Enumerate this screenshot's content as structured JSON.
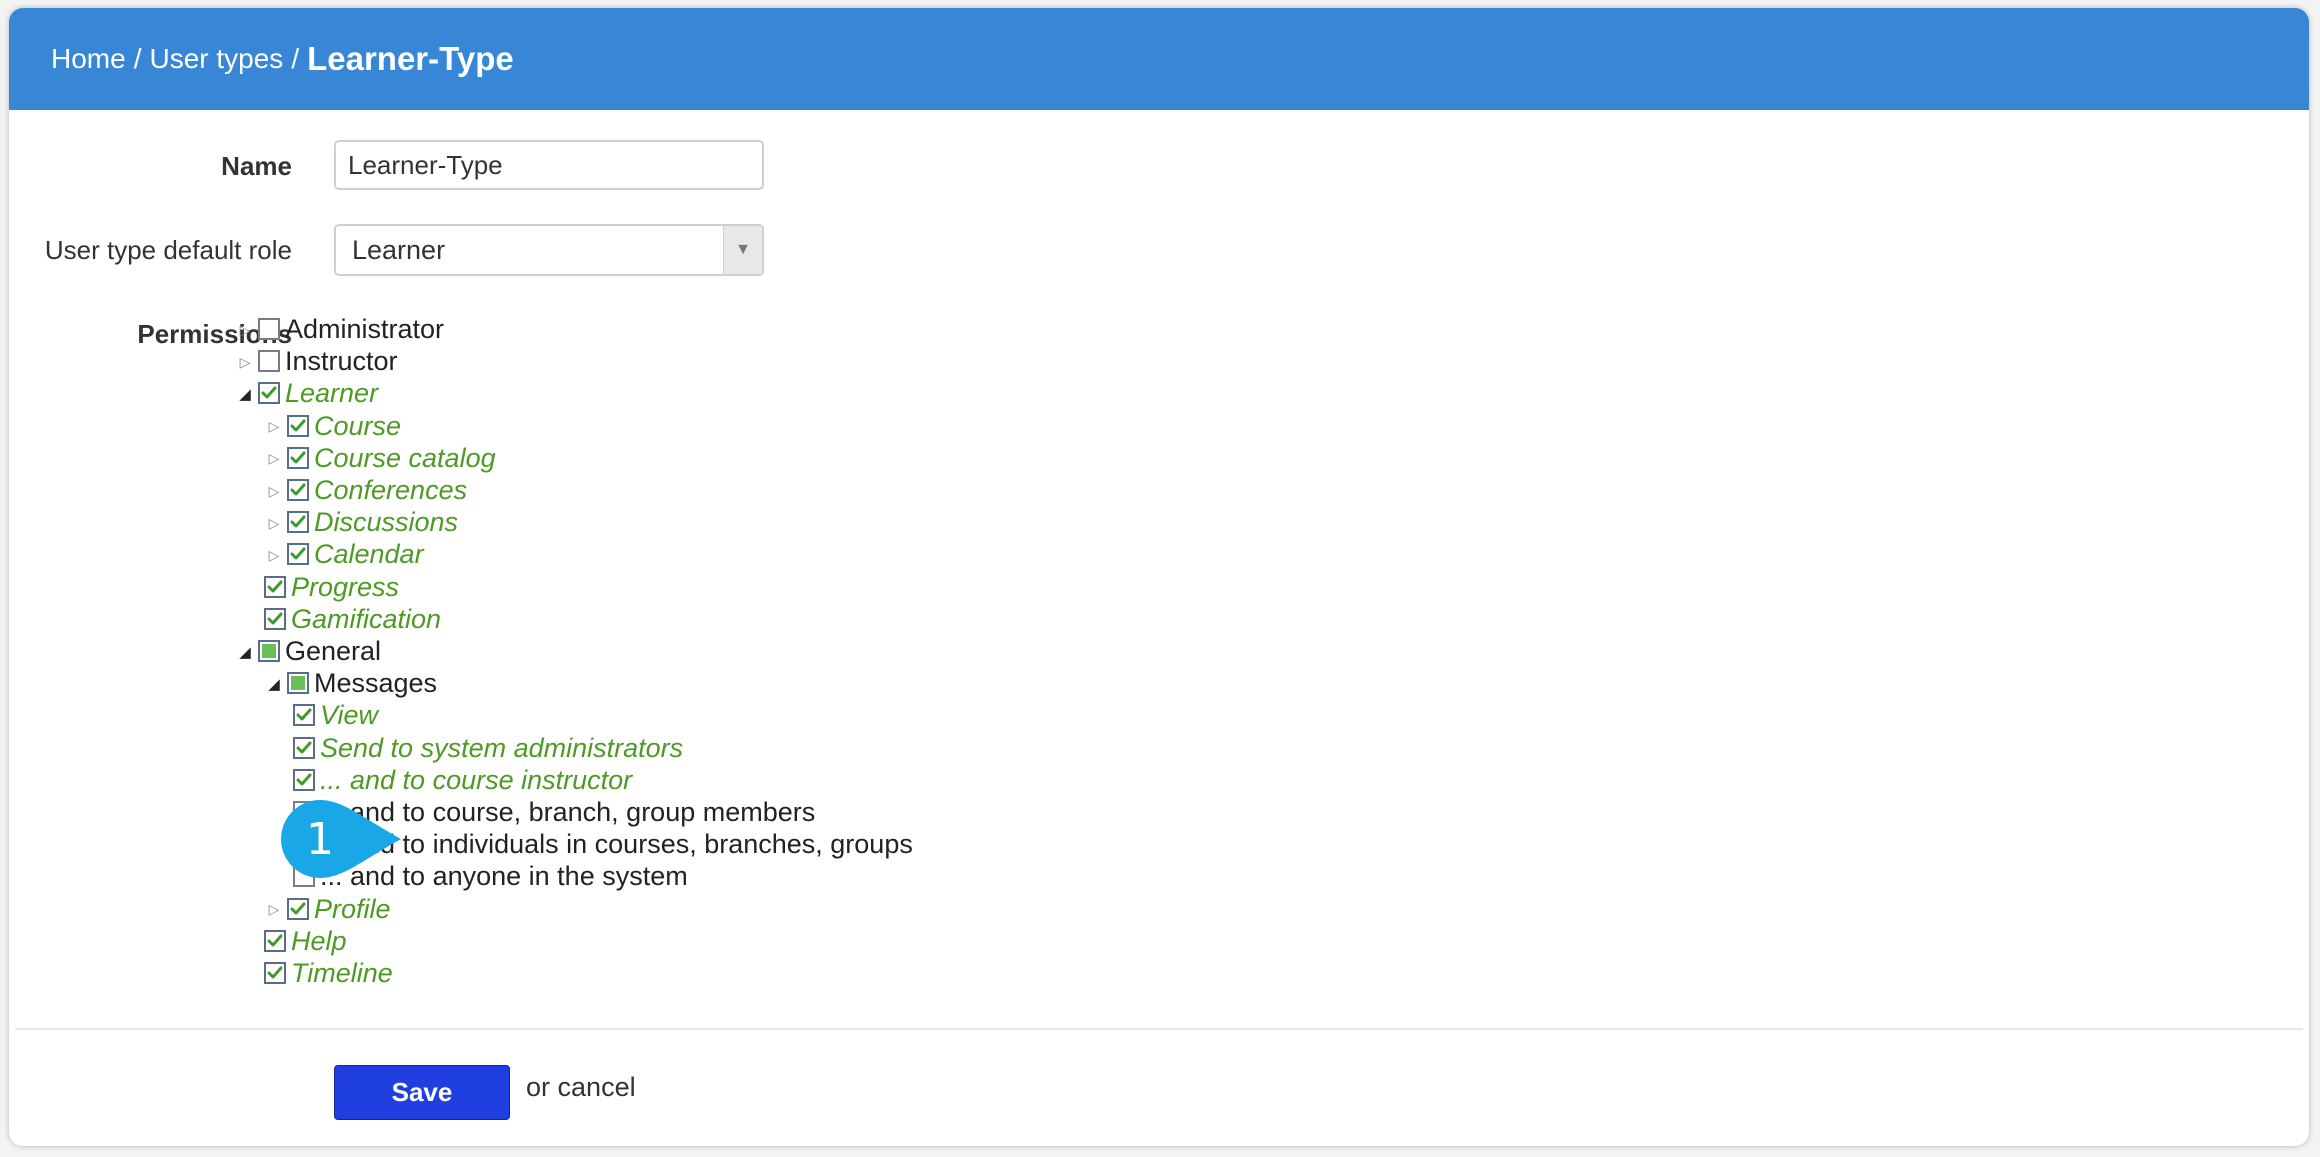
{
  "breadcrumb": {
    "home": "Home",
    "sep1": "/",
    "user_types": "User types",
    "sep2": "/",
    "current": "Learner-Type"
  },
  "form": {
    "name_label": "Name",
    "name_value": "Learner-Type",
    "role_label": "User type default role",
    "role_value": "Learner",
    "permissions_label": "Permissions"
  },
  "permissions": [
    {
      "label": "Administrator",
      "level": 0,
      "toggle": "collapsed",
      "state": "unchecked"
    },
    {
      "label": "Instructor",
      "level": 0,
      "toggle": "collapsed",
      "state": "unchecked"
    },
    {
      "label": "Learner",
      "level": 0,
      "toggle": "expanded",
      "state": "checked"
    },
    {
      "label": "Course",
      "level": 1,
      "toggle": "collapsed",
      "state": "checked"
    },
    {
      "label": "Course catalog",
      "level": 1,
      "toggle": "collapsed",
      "state": "checked"
    },
    {
      "label": "Conferences",
      "level": 1,
      "toggle": "collapsed",
      "state": "checked"
    },
    {
      "label": "Discussions",
      "level": 1,
      "toggle": "collapsed",
      "state": "checked"
    },
    {
      "label": "Calendar",
      "level": 1,
      "toggle": "collapsed",
      "state": "checked"
    },
    {
      "label": "Progress",
      "level": 1,
      "toggle": "none",
      "state": "checked"
    },
    {
      "label": "Gamification",
      "level": 1,
      "toggle": "none",
      "state": "checked"
    },
    {
      "label": "General",
      "level": 0,
      "toggle": "expanded",
      "state": "partial"
    },
    {
      "label": "Messages",
      "level": 1,
      "toggle": "expanded",
      "state": "partial"
    },
    {
      "label": "View",
      "level": 2,
      "toggle": "none",
      "state": "checked"
    },
    {
      "label": "Send to system administrators",
      "level": 2,
      "toggle": "none",
      "state": "checked"
    },
    {
      "label": "... and to course instructor",
      "level": 2,
      "toggle": "none",
      "state": "checked"
    },
    {
      "label": "... and to course, branch, group members",
      "level": 2,
      "toggle": "none",
      "state": "unchecked"
    },
    {
      "label": "... and to individuals in courses, branches, groups",
      "level": 2,
      "toggle": "none",
      "state": "unchecked"
    },
    {
      "label": "... and to anyone in the system",
      "level": 2,
      "toggle": "none",
      "state": "unchecked"
    },
    {
      "label": "Profile",
      "level": 1,
      "toggle": "collapsed",
      "state": "checked"
    },
    {
      "label": "Help",
      "level": 1,
      "toggle": "none",
      "state": "checked"
    },
    {
      "label": "Timeline",
      "level": 1,
      "toggle": "none",
      "state": "checked"
    }
  ],
  "callout": {
    "number": "1"
  },
  "actions": {
    "save_label": "Save",
    "or_text": "or",
    "cancel_label": "cancel"
  },
  "colors": {
    "header_bg": "#3787d6",
    "checked_text": "#4d9a24",
    "save_button": "#1f3fe0",
    "callout": "#1aa7e8"
  }
}
